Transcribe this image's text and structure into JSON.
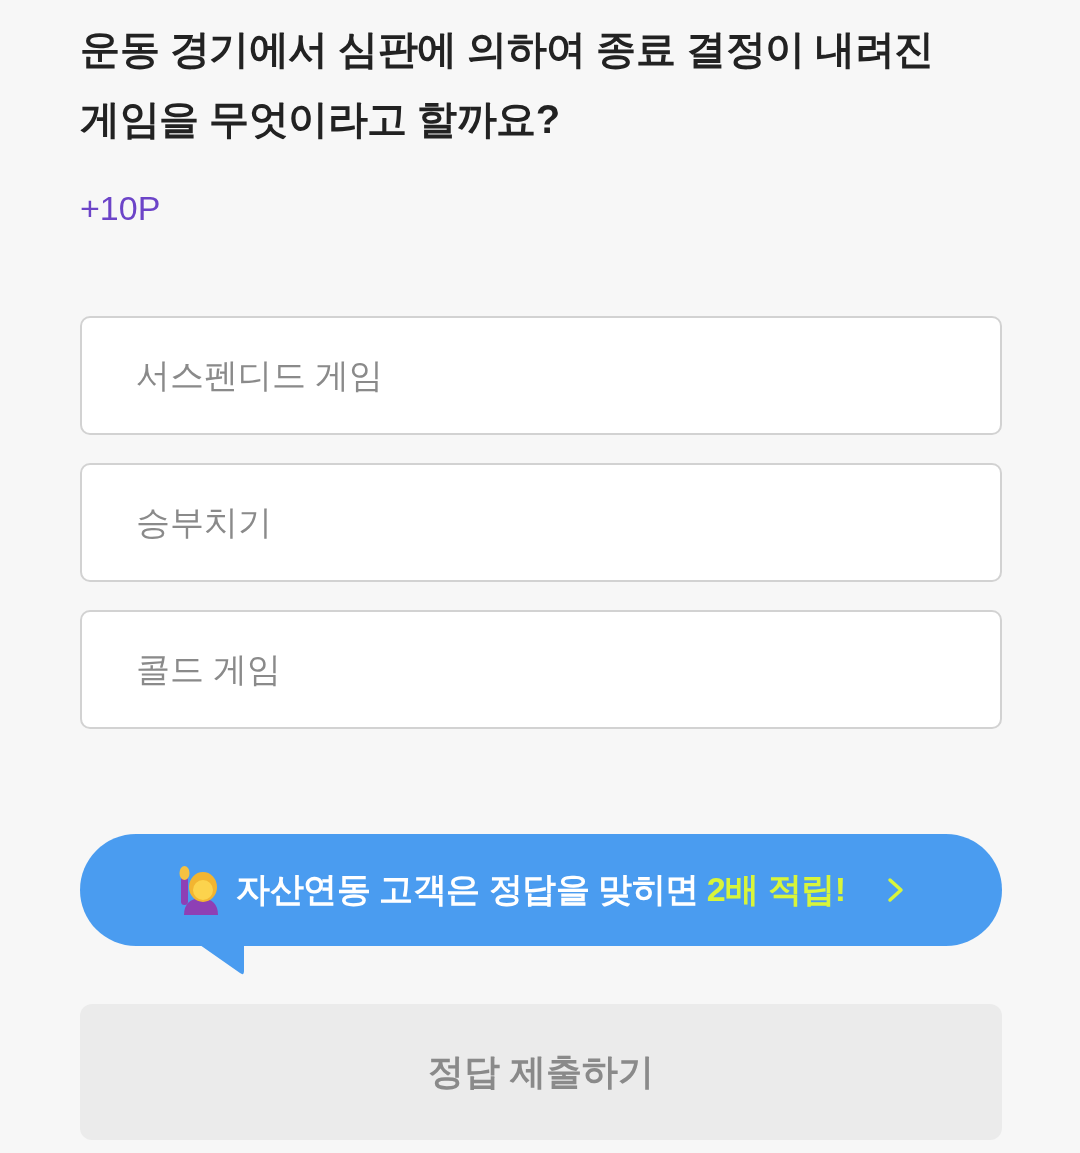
{
  "question": {
    "title": "운동 경기에서 심판에 의하여 종료 결정이 내려진 게임을 무엇이라고 할까요?",
    "points": "+10P"
  },
  "options": [
    {
      "label": "서스펜디드 게임",
      "selected": false
    },
    {
      "label": "승부치기",
      "selected": false
    },
    {
      "label": "콜드 게임",
      "selected": false
    }
  ],
  "promo_banner": {
    "text": "자산연동 고객은 정답을 맞히면",
    "highlight": "2배 적립!"
  },
  "submit_button": {
    "label": "정답 제출하기",
    "disabled": true
  }
}
